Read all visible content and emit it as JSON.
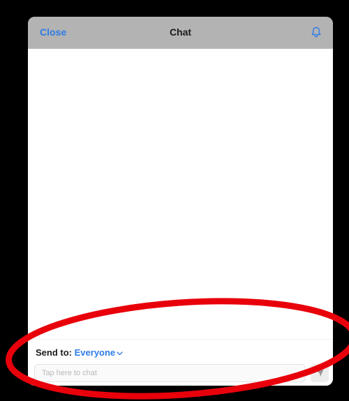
{
  "header": {
    "close_label": "Close",
    "title": "Chat",
    "notification_icon": "bell-icon"
  },
  "footer": {
    "send_to_label": "Send to:",
    "recipient": "Everyone",
    "recipient_icon": "chevron-down-icon",
    "input_placeholder": "Tap here to chat",
    "input_value": "",
    "send_icon": "send-icon"
  },
  "colors": {
    "accent": "#2e7ce6",
    "header_bg": "#b3b3b3",
    "annotation": "#e8000b"
  },
  "annotation": {
    "shape": "ellipse",
    "color": "#e8000b"
  }
}
